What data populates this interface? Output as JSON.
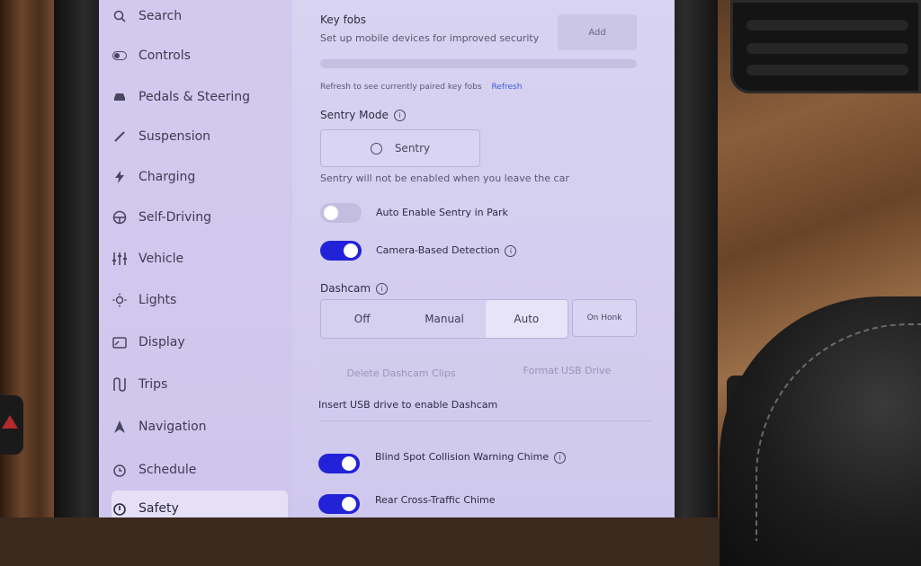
{
  "sidebar": {
    "items": [
      {
        "label": "Search",
        "icon": "search-icon"
      },
      {
        "label": "Controls",
        "icon": "toggle-icon"
      },
      {
        "label": "Pedals & Steering",
        "icon": "car-icon"
      },
      {
        "label": "Suspension",
        "icon": "suspension-icon"
      },
      {
        "label": "Charging",
        "icon": "lightning-icon"
      },
      {
        "label": "Self-Driving",
        "icon": "steering-wheel-icon"
      },
      {
        "label": "Vehicle",
        "icon": "sliders-icon"
      },
      {
        "label": "Lights",
        "icon": "sun-icon"
      },
      {
        "label": "Display",
        "icon": "display-icon"
      },
      {
        "label": "Trips",
        "icon": "route-icon"
      },
      {
        "label": "Navigation",
        "icon": "navigation-arrow-icon"
      },
      {
        "label": "Schedule",
        "icon": "clock-icon"
      },
      {
        "label": "Safety",
        "icon": "safety-icon"
      }
    ]
  },
  "keyfobs": {
    "title": "Key fobs",
    "subtitle": "Set up mobile devices for improved security",
    "add_label": "Add",
    "refresh_text": "Refresh to see currently paired key fobs",
    "refresh_link": "Refresh"
  },
  "sentry": {
    "title": "Sentry Mode",
    "button_label": "Sentry",
    "status": "Sentry will not be enabled when you leave the car",
    "auto_enable_label": "Auto Enable Sentry in Park",
    "auto_enable_on": false,
    "camera_detection_label": "Camera-Based Detection",
    "camera_detection_on": true
  },
  "dashcam": {
    "title": "Dashcam",
    "options": [
      "Off",
      "Manual",
      "Auto"
    ],
    "selected": "Auto",
    "on_honk_label": "On Honk",
    "delete_label": "Delete Dashcam Clips",
    "format_label": "Format USB Drive",
    "insert_usb_text": "Insert USB drive to enable Dashcam"
  },
  "chimes": {
    "blind_spot_label": "Blind Spot Collision Warning Chime",
    "blind_spot_on": true,
    "rear_cross_label": "Rear Cross-Traffic Chime",
    "rear_cross_on": true
  },
  "colors": {
    "accent": "#2222d8",
    "screen_bg": "#d5cff0",
    "link": "#3a5bd8"
  }
}
